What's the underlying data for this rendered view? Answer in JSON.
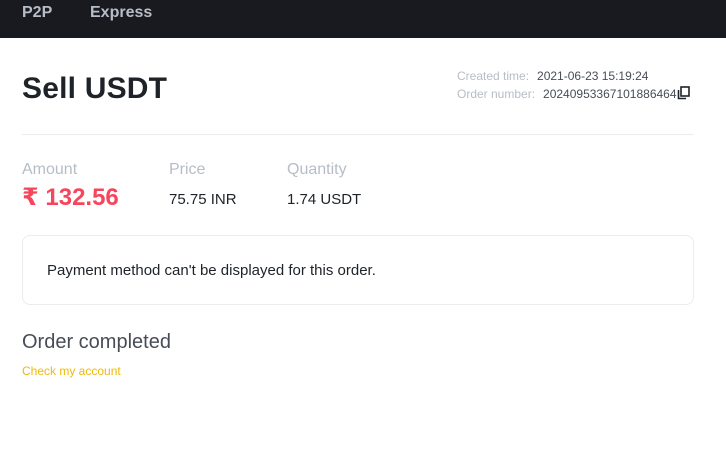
{
  "nav": {
    "items": [
      {
        "label": "P2P"
      },
      {
        "label": "Express"
      }
    ]
  },
  "order": {
    "title": "Sell USDT",
    "created_label": "Created time:",
    "created_value": "2021-06-23 15:19:24",
    "number_label": "Order number:",
    "number_value": "20240953367101886464"
  },
  "stats": {
    "amount_label": "Amount",
    "amount_value": "₹ 132.56",
    "price_label": "Price",
    "price_value": "75.75 INR",
    "quantity_label": "Quantity",
    "quantity_value": "1.74 USDT"
  },
  "notice": {
    "text": "Payment method can't be displayed for this order."
  },
  "status": {
    "title": "Order completed",
    "link_label": "Check my account"
  },
  "colors": {
    "nav_bg": "#181a20",
    "amount": "#f6465d",
    "link": "#f0b90b"
  },
  "icons": {
    "copy": "copy-icon"
  }
}
